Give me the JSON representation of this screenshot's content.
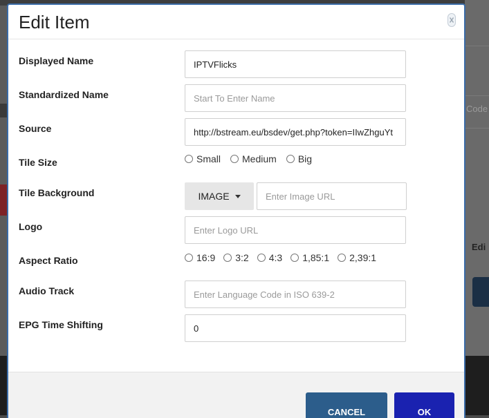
{
  "background": {
    "right_text_top": "Code",
    "right_text_mid": "Edi"
  },
  "modal": {
    "title": "Edit Item",
    "close_icon": "close-icon",
    "fields": {
      "displayed_name": {
        "label": "Displayed Name",
        "value": "IPTVFlicks"
      },
      "standardized_name": {
        "label": "Standardized Name",
        "value": "",
        "placeholder": "Start To Enter Name"
      },
      "source": {
        "label": "Source",
        "value": "http://bstream.eu/bsdev/get.php?token=IIwZhguYt"
      },
      "tile_size": {
        "label": "Tile Size",
        "options": [
          "Small",
          "Medium",
          "Big"
        ]
      },
      "tile_background": {
        "label": "Tile Background",
        "dropdown_label": "IMAGE",
        "placeholder": "Enter Image URL"
      },
      "logo": {
        "label": "Logo",
        "placeholder": "Enter Logo URL"
      },
      "aspect_ratio": {
        "label": "Aspect Ratio",
        "options": [
          "16:9",
          "3:2",
          "4:3",
          "1,85:1",
          "2,39:1"
        ]
      },
      "audio_track": {
        "label": "Audio Track",
        "placeholder": "Enter Language Code in ISO 639-2"
      },
      "epg_time_shifting": {
        "label": "EPG Time Shifting",
        "value": "0"
      }
    },
    "footer": {
      "cancel_label": "CANCEL",
      "ok_label": "OK"
    }
  },
  "colors": {
    "cancel": "#2c5d8b",
    "ok": "#1a22b0",
    "modal_border": "#3b6ca8"
  }
}
